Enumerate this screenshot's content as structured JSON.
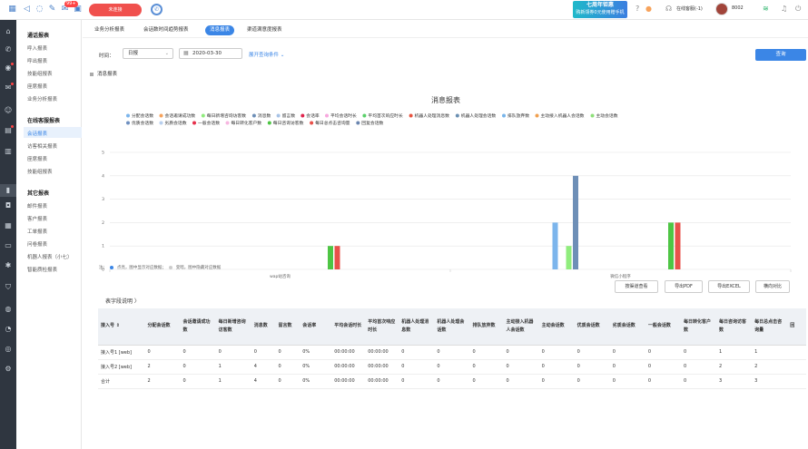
{
  "topbar": {
    "status_button": "未连接",
    "badge": "99+",
    "promo_title": "七周年钜惠",
    "promo_sub": "购新领券0元使用赠手机",
    "online": "在线客服(-1)",
    "agent": "8002"
  },
  "colors": {
    "primary": "#3b86e6",
    "danger": "#f0504d",
    "rail": "#2f3640"
  },
  "sidebar": {
    "groups": [
      {
        "title": "通话报表",
        "items": [
          "呼入报表",
          "呼出报表",
          "技能组报表",
          "座席报表",
          "业务分析报表"
        ]
      },
      {
        "title": "在线客服报表",
        "items": [
          "会话报表",
          "访客相关报表",
          "座席报表",
          "技能组报表"
        ]
      },
      {
        "title": "其它报表",
        "items": [
          "邮件报表",
          "客户报表",
          "工单报表",
          "问卷报表",
          "机器人报表（小七）",
          "智能质检报表"
        ]
      }
    ],
    "active": "会话报表"
  },
  "tabs": [
    "业务分析报表",
    "会话数时间趋势报表",
    "消息报表",
    "渠道满意度报表"
  ],
  "filters": {
    "time_label": "时间：",
    "period": "日报",
    "date": "2020-03-30",
    "expand": "展开查询条件 ⌄",
    "query_button": "查询"
  },
  "section_title": "消息报表",
  "chart_data": {
    "type": "bar",
    "title": "消息报表",
    "categories": [
      "wap站咨询",
      "微信小程序"
    ],
    "ylim": [
      0,
      5
    ],
    "yticks": [
      0,
      1,
      2,
      3,
      4,
      5
    ],
    "legend_position": "top",
    "series": [
      {
        "name": "分配会话数",
        "color": "#7cb5ec",
        "values": [
          0,
          2
        ]
      },
      {
        "name": "会话邀请成功数",
        "color": "#f7a35c",
        "values": [
          0,
          0
        ]
      },
      {
        "name": "每日新增咨询访客数",
        "color": "#90ed7d",
        "values": [
          0,
          1
        ]
      },
      {
        "name": "消息数",
        "color": "#6e8fb7",
        "values": [
          0,
          4
        ]
      },
      {
        "name": "留言数",
        "color": "#a7c3e6",
        "values": [
          0,
          0
        ]
      },
      {
        "name": "会话率",
        "color": "#e0244c",
        "values": [
          0,
          0
        ]
      },
      {
        "name": "平均会话时长",
        "color": "#f7a8de",
        "values": [
          0,
          0
        ]
      },
      {
        "name": "平均首次响应时长",
        "color": "#5ad06a",
        "values": [
          0,
          0
        ]
      },
      {
        "name": "机器人处理消息数",
        "color": "#e8533f",
        "values": [
          0,
          0
        ]
      },
      {
        "name": "机器人处理会话数",
        "color": "#6a8fb2",
        "values": [
          0,
          0
        ]
      },
      {
        "name": "排队放弃数",
        "color": "#79b5ea",
        "values": [
          0,
          0
        ]
      },
      {
        "name": "主动接入机器人会话数",
        "color": "#f0a050",
        "values": [
          0,
          0
        ]
      },
      {
        "name": "主动会话数",
        "color": "#8ee07a",
        "values": [
          0,
          0
        ]
      },
      {
        "name": "优质会话数",
        "color": "#6f90c0",
        "values": [
          0,
          0
        ]
      },
      {
        "name": "劣质会话数",
        "color": "#b9d0ee",
        "values": [
          0,
          0
        ]
      },
      {
        "name": "一般会话数",
        "color": "#e6304c",
        "values": [
          0,
          0
        ]
      },
      {
        "name": "每日转化客户数",
        "color": "#f7b6e0",
        "values": [
          0,
          0
        ]
      },
      {
        "name": "每日咨询访客数",
        "color": "#4ec544",
        "values": [
          1,
          2
        ]
      },
      {
        "name": "每日总点击咨询量",
        "color": "#e8514a",
        "values": [
          1,
          2
        ]
      },
      {
        "name": "回复会话数",
        "color": "#6b86b0",
        "values": [
          0,
          0
        ]
      }
    ]
  },
  "note": {
    "prefix": "注：",
    "a": "点亮，图中显示对应数据；",
    "b": "变暗，图中隐藏对应数据"
  },
  "actions": [
    "按渠道查看",
    "导出PDF",
    "导出EXCEL",
    "横向对比"
  ],
  "fields_link": "表字段说明  〉",
  "table": {
    "headers": [
      "接入号 ⇕",
      "分配会话数",
      "会话邀请成功数",
      "每日新增咨询访客数",
      "消息数",
      "留言数",
      "会话率",
      "平均会话时长",
      "平均首次响应时长",
      "机器人处理消息数",
      "机器人处理会话数",
      "排队放弃数",
      "主动接入机器人会话数",
      "主动会话数",
      "优质会话数",
      "劣质会话数",
      "一般会话数",
      "每日转化客户数",
      "每日咨询访客数",
      "每日总点击咨询量",
      "回"
    ],
    "rows": [
      [
        "接入号1 [web]",
        "0",
        "0",
        "0",
        "0",
        "0",
        "0%",
        "00:00:00",
        "00:00:00",
        "0",
        "0",
        "0",
        "0",
        "0",
        "0",
        "0",
        "0",
        "0",
        "1",
        "1",
        ""
      ],
      [
        "接入号2 [web]",
        "2",
        "0",
        "1",
        "4",
        "0",
        "0%",
        "00:00:00",
        "00:00:00",
        "0",
        "0",
        "0",
        "0",
        "0",
        "0",
        "0",
        "0",
        "0",
        "2",
        "2",
        ""
      ],
      [
        "合计",
        "2",
        "0",
        "1",
        "4",
        "0",
        "0%",
        "00:00:00",
        "00:00:00",
        "0",
        "0",
        "0",
        "0",
        "0",
        "0",
        "0",
        "0",
        "0",
        "3",
        "3",
        ""
      ]
    ]
  }
}
